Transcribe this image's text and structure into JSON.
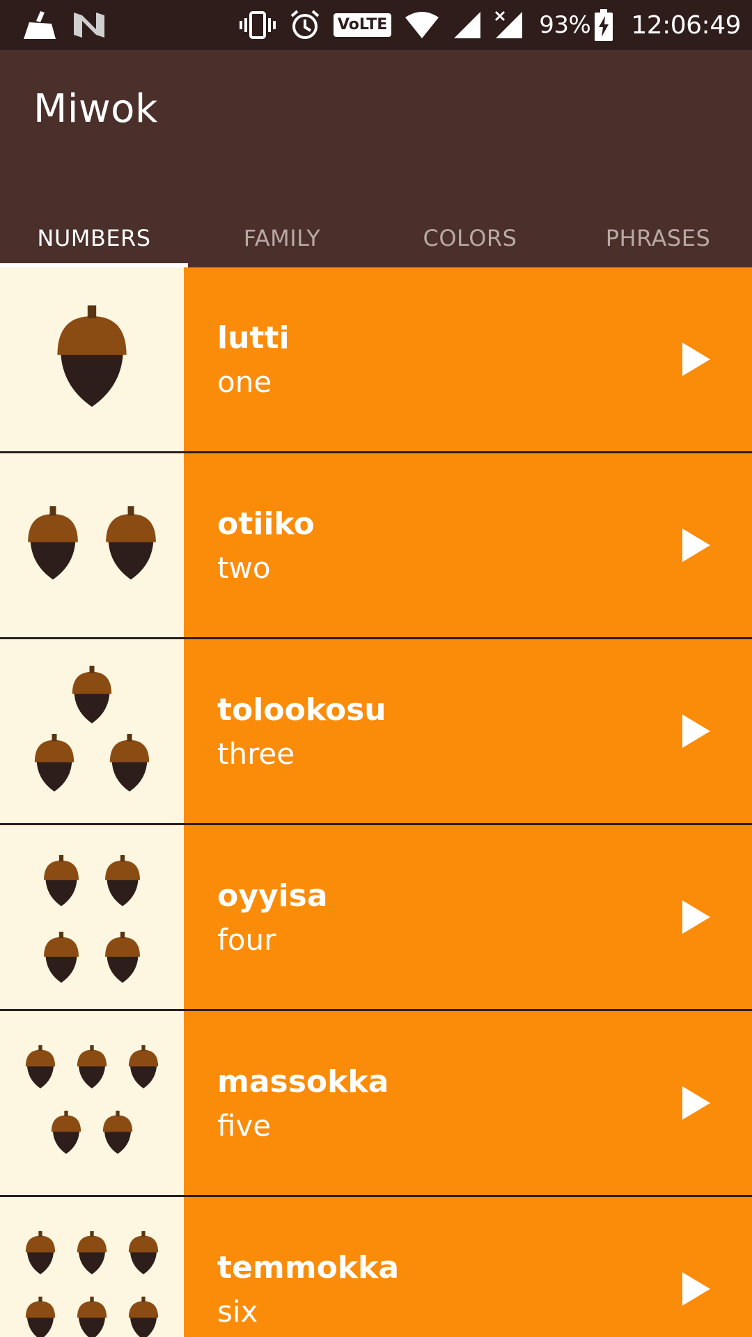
{
  "statusbar": {
    "battery": "93%",
    "time": "12:06:49",
    "volte_label": "VoLTE",
    "icons": [
      "cleaner-icon",
      "n-icon",
      "vibrate-icon",
      "alarm-icon",
      "volte-icon",
      "wifi-icon",
      "signal-icon",
      "signal-no-data-icon",
      "battery-charging-icon"
    ]
  },
  "app": {
    "title": "Miwok"
  },
  "tabs": [
    {
      "label": "NUMBERS",
      "active": true
    },
    {
      "label": "FAMILY",
      "active": false
    },
    {
      "label": "COLORS",
      "active": false
    },
    {
      "label": "PHRASES",
      "active": false
    }
  ],
  "words": [
    {
      "miwok": "lutti",
      "english": "one",
      "acorns": 1
    },
    {
      "miwok": "otiiko",
      "english": "two",
      "acorns": 2
    },
    {
      "miwok": "tolookosu",
      "english": "three",
      "acorns": 3
    },
    {
      "miwok": "oyyisa",
      "english": "four",
      "acorns": 4
    },
    {
      "miwok": "massokka",
      "english": "five",
      "acorns": 5
    },
    {
      "miwok": "temmokka",
      "english": "six",
      "acorns": 6
    }
  ],
  "colors": {
    "statusbar": "#2e1d1b",
    "appbar": "#4a2f2a",
    "item_background": "#fb8c0a",
    "thumb_background": "#fdf7e1",
    "acorn_cap": "#8b4c14",
    "acorn_body": "#2e1e1b"
  }
}
